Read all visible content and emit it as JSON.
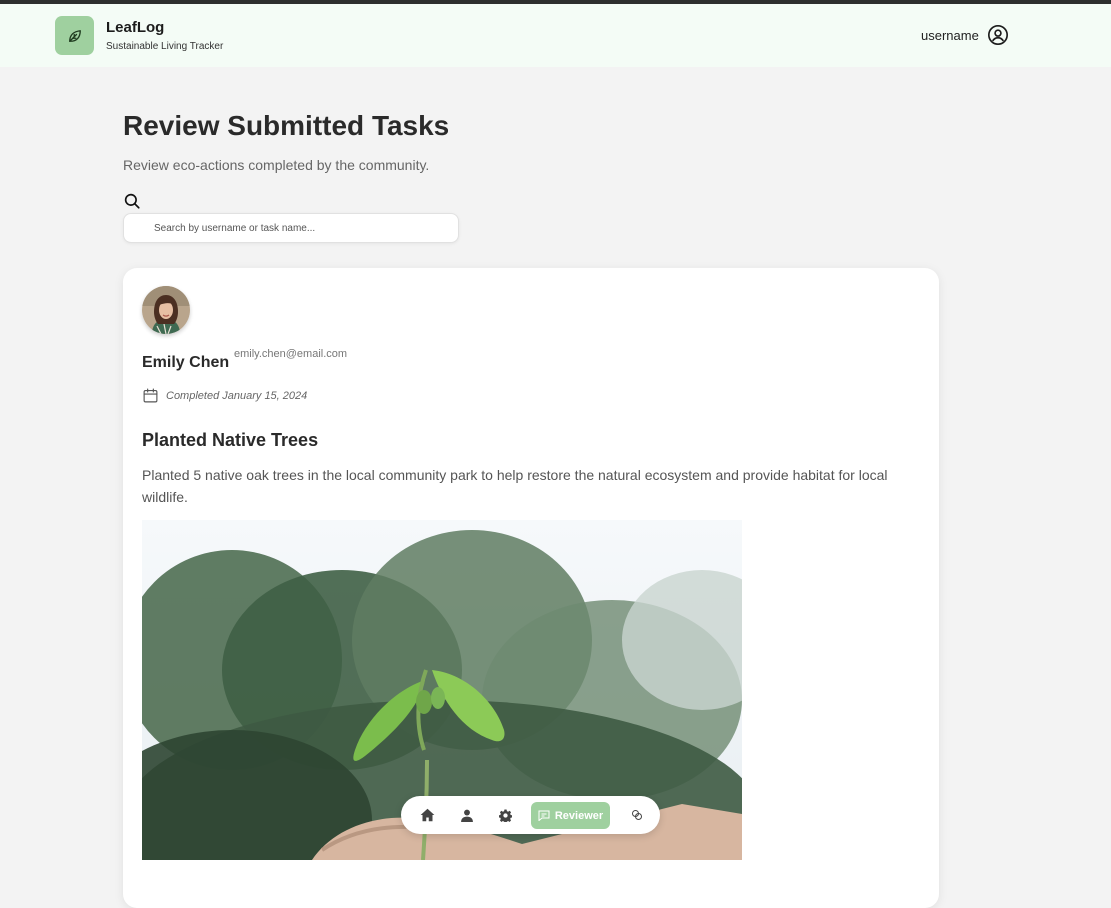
{
  "app": {
    "name": "LeafLog",
    "tagline": "Sustainable Living Tracker",
    "brand_color": "#9fd09f"
  },
  "user_menu": {
    "username": "username",
    "icon": "user-circle-icon"
  },
  "page": {
    "title": "Review Submitted Tasks",
    "subtitle": "Review eco-actions completed by the community."
  },
  "search": {
    "icon": "search-icon",
    "placeholder": "Search by username or task name...",
    "value": ""
  },
  "submissions": [
    {
      "name": "Emily Chen",
      "email": "emily.chen@email.com",
      "completed": "Completed January 15, 2024",
      "task_title": "Planted Native Trees",
      "task_description": "Planted 5 native oak trees in the local community park to help restore the natural ecosystem and provide habitat for local wildlife.",
      "image_icon": "seedling-photo"
    }
  ],
  "bottom_nav": {
    "items": [
      {
        "icon": "home-icon"
      },
      {
        "icon": "profile-icon"
      },
      {
        "icon": "settings-icon"
      },
      {
        "icon": "reviewer-icon",
        "label": "Reviewer",
        "active": true
      },
      {
        "icon": "coins-icon"
      }
    ]
  }
}
